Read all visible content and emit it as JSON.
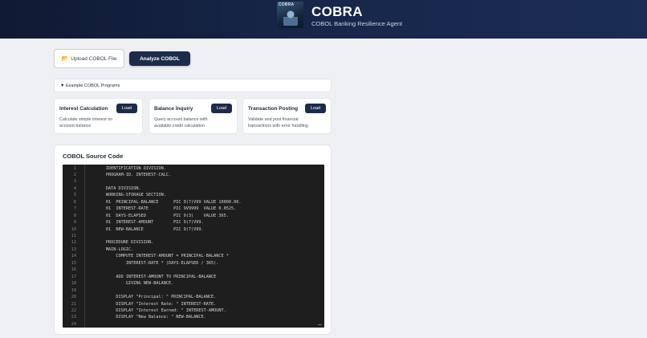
{
  "header": {
    "logo_text": "COBRA",
    "title": "COBRA",
    "subtitle": "COBOL Banking Resilience Agent"
  },
  "toolbar": {
    "upload_label": "Upload COBOL File",
    "upload_icon": "upload-icon",
    "analyze_label": "Analyze COBOL"
  },
  "examples": {
    "toggle_label": "▼ Example COBOL Programs",
    "cards": [
      {
        "title": "Interest Calculation",
        "description": "Calculate simple interest on account balance",
        "load_label": "Load"
      },
      {
        "title": "Balance Inquiry",
        "description": "Query account balance with available credit calculation",
        "load_label": "Load"
      },
      {
        "title": "Transaction Posting",
        "description": "Validate and post financial transactions with error handling",
        "load_label": "Load"
      }
    ]
  },
  "source": {
    "title": "COBOL Source Code",
    "lines": [
      {
        "n": "1",
        "code": "       IDENTIFICATION DIVISION."
      },
      {
        "n": "2",
        "code": "       PROGRAM-ID. INTEREST-CALC."
      },
      {
        "n": "3",
        "code": ""
      },
      {
        "n": "4",
        "code": "       DATA DIVISION."
      },
      {
        "n": "5",
        "code": "       WORKING-STORAGE SECTION."
      },
      {
        "n": "6",
        "code": "       01  PRINCIPAL-BALANCE      PIC 9(7)V99 VALUE 10000.00."
      },
      {
        "n": "7",
        "code": "       01  INTEREST-RATE          PIC 9V9999  VALUE 0.0525."
      },
      {
        "n": "8",
        "code": "       01  DAYS-ELAPSED           PIC 9(3)    VALUE 365."
      },
      {
        "n": "9",
        "code": "       01  INTEREST-AMOUNT        PIC 9(7)V99."
      },
      {
        "n": "10",
        "code": "       01  NEW-BALANCE            PIC 9(7)V99."
      },
      {
        "n": "11",
        "code": ""
      },
      {
        "n": "12",
        "code": "       PROCEDURE DIVISION."
      },
      {
        "n": "13",
        "code": "       MAIN-LOGIC."
      },
      {
        "n": "14",
        "code": "           COMPUTE INTEREST-AMOUNT = PRINCIPAL-BALANCE *"
      },
      {
        "n": "15",
        "code": "               INTEREST-RATE * (DAYS-ELAPSED / 365)."
      },
      {
        "n": "16",
        "code": ""
      },
      {
        "n": "17",
        "code": "           ADD INTEREST-AMOUNT TO PRINCIPAL-BALANCE"
      },
      {
        "n": "18",
        "code": "               GIVING NEW-BALANCE."
      },
      {
        "n": "19",
        "code": ""
      },
      {
        "n": "20",
        "code": "           DISPLAY \"Principal: \" PRINCIPAL-BALANCE."
      },
      {
        "n": "21",
        "code": "           DISPLAY \"Interest Rate: \" INTEREST-RATE."
      },
      {
        "n": "22",
        "code": "           DISPLAY \"Interest Earned: \" INTEREST-AMOUNT."
      },
      {
        "n": "23",
        "code": "           DISPLAY \"New Balance: \" NEW-BALANCE."
      },
      {
        "n": "24",
        "code": ""
      }
    ]
  },
  "colors": {
    "header_bg": "#17264a",
    "accent": "#1c2b4a",
    "editor_bg": "#1e1e1e"
  }
}
